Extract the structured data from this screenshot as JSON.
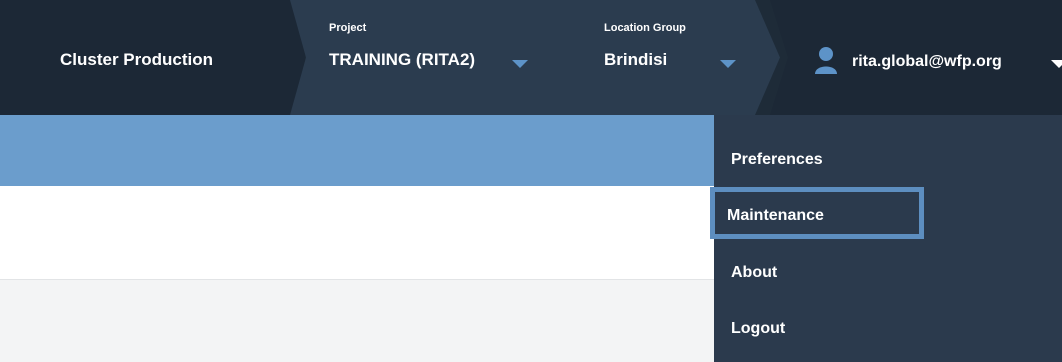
{
  "topbar": {
    "cluster": "Cluster Production",
    "project": {
      "label": "Project",
      "value": "TRAINING (RITA2)"
    },
    "location_group": {
      "label": "Location Group",
      "value": "Brindisi"
    },
    "user": {
      "email": "rita.global@wfp.org"
    }
  },
  "user_menu": {
    "items": [
      "Preferences",
      "Maintenance",
      "About",
      "Logout"
    ],
    "focused_item": "Maintenance"
  },
  "colors": {
    "topbar": "#1c2836",
    "selector_bg": "#2b3c4f",
    "accent_band": "#6b9dcc",
    "menu_bg": "#2b3a4d",
    "focus_ring": "#5d8ec0",
    "caret": "#5d93c8"
  },
  "icons": [
    "user-icon",
    "chevron-down-icon"
  ]
}
